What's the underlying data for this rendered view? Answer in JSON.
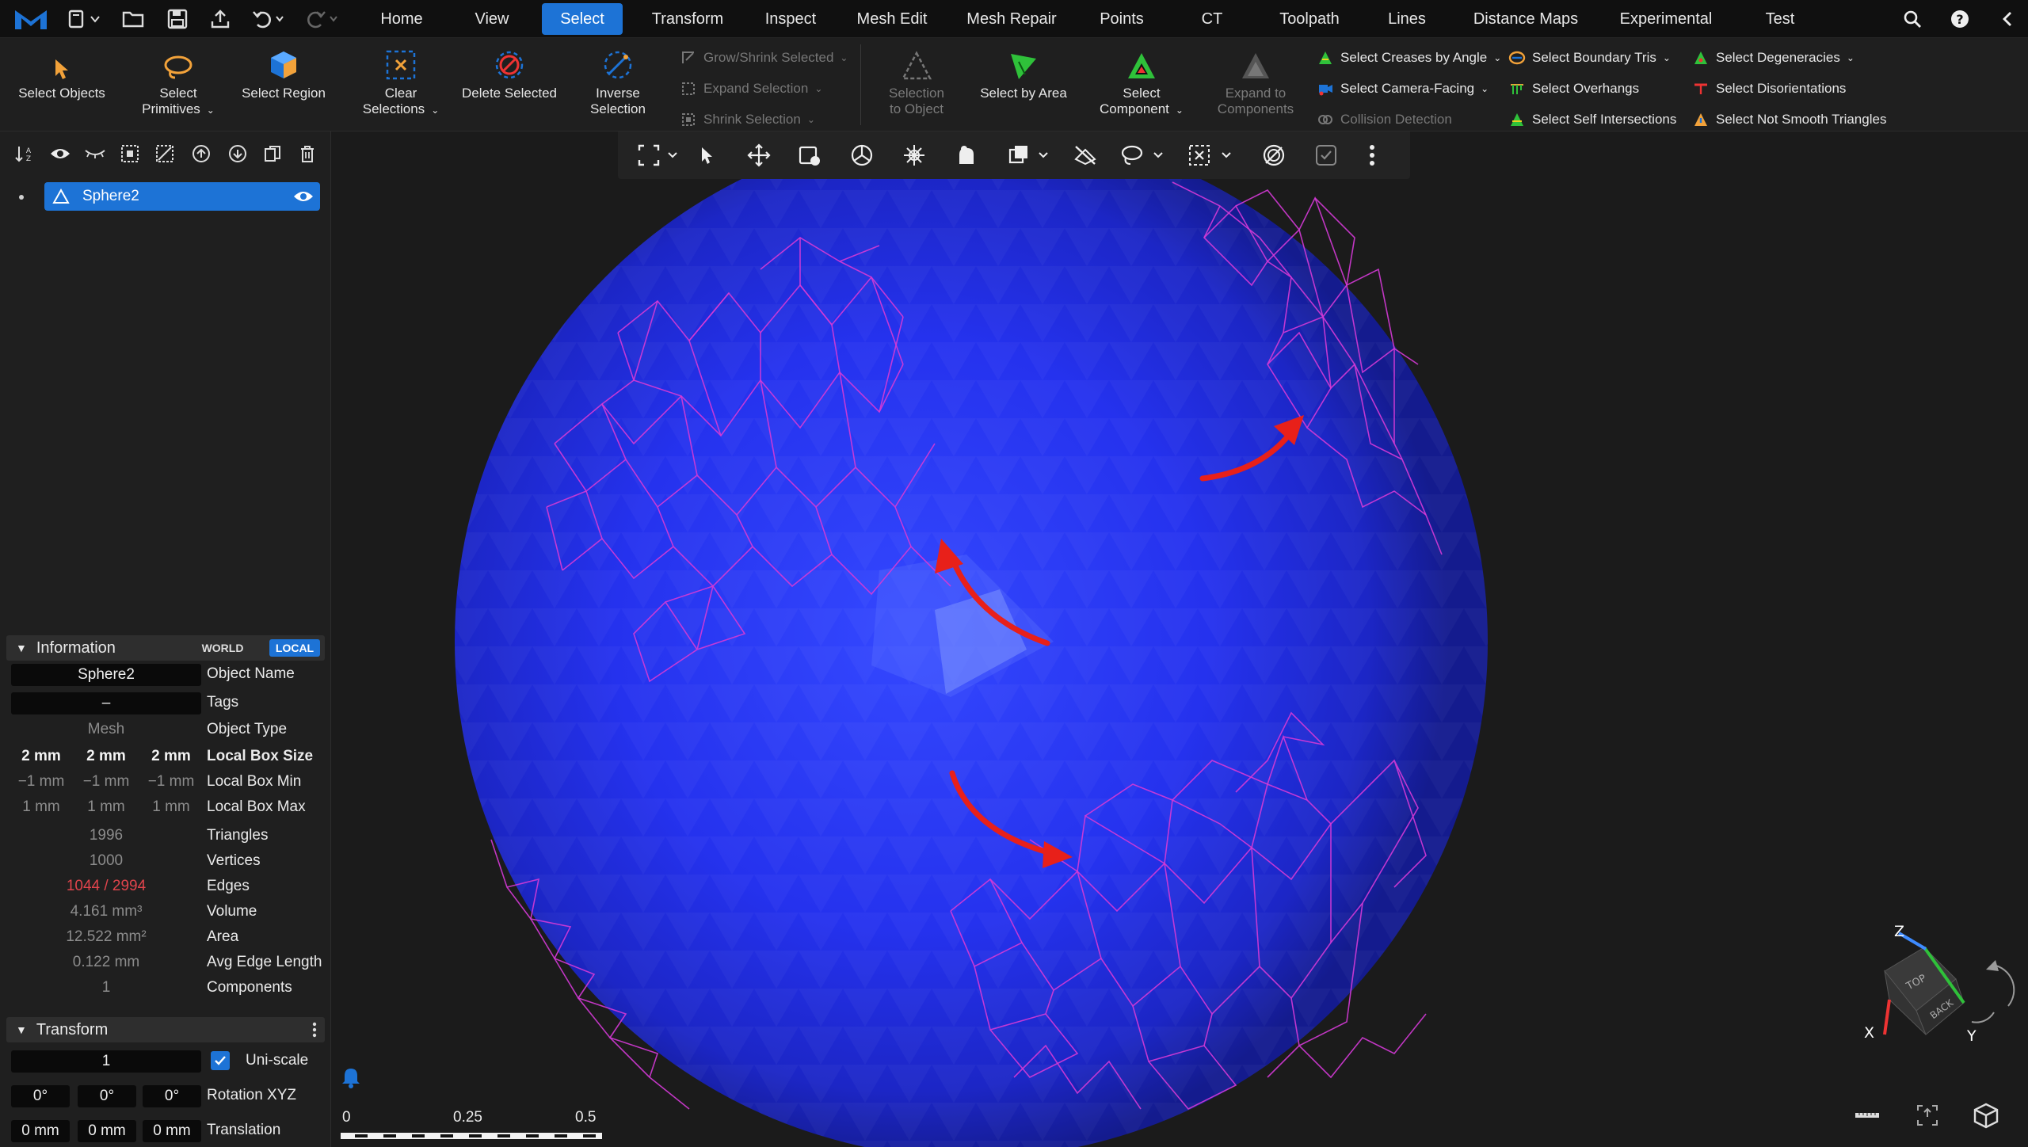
{
  "menubar": {
    "tabs": [
      "Home",
      "View",
      "Select",
      "Transform",
      "Inspect",
      "Mesh Edit",
      "Mesh Repair",
      "Points",
      "CT",
      "Toolpath",
      "Lines",
      "Distance Maps",
      "Experimental",
      "Test"
    ],
    "active_tab": "Select"
  },
  "ribbon": {
    "select_objects": "Select Objects",
    "select_primitives": "Select\nPrimitives",
    "select_region": "Select Region",
    "clear_selections": "Clear\nSelections",
    "delete_selected": "Delete Selected",
    "inverse_selection": "Inverse\nSelection",
    "grow_shrink_selected": "Grow/Shrink Selected",
    "expand_selection": "Expand Selection",
    "shrink_selection": "Shrink Selection",
    "selection_to_object": "Selection\nto Object",
    "select_by_area": "Select by Area",
    "select_component": "Select\nComponent",
    "expand_to_components": "Expand to\nComponents",
    "select_creases_by_angle": "Select Creases by Angle",
    "select_camera_facing": "Select Camera-Facing",
    "collision_detection": "Collision Detection",
    "select_boundary_tris": "Select Boundary Tris",
    "select_overhangs": "Select Overhangs",
    "select_self_intersections": "Select Self Intersections",
    "select_degeneracies": "Select Degeneracies",
    "select_disorientations": "Select Disorientations",
    "select_not_smooth_triangles": "Select Not Smooth Triangles"
  },
  "scene_tree": {
    "items": [
      {
        "label": "Sphere2",
        "visible": true,
        "selected": true
      }
    ]
  },
  "information": {
    "title": "Information",
    "world_label": "WORLD",
    "local_label": "LOCAL",
    "active_frame": "LOCAL",
    "object_name_value": "Sphere2",
    "object_name_label": "Object Name",
    "tags_value": "–",
    "tags_label": "Tags",
    "object_type_value": "Mesh",
    "object_type_label": "Object Type",
    "local_box_size": [
      "2 mm",
      "2 mm",
      "2 mm"
    ],
    "local_box_size_label": "Local Box Size",
    "local_box_min": [
      "−1 mm",
      "−1 mm",
      "−1 mm"
    ],
    "local_box_min_label": "Local Box Min",
    "local_box_max": [
      "1 mm",
      "1 mm",
      "1 mm"
    ],
    "local_box_max_label": "Local Box Max",
    "triangles_value": "1996",
    "triangles_label": "Triangles",
    "vertices_value": "1000",
    "vertices_label": "Vertices",
    "edges_value": "1044 / 2994",
    "edges_label": "Edges",
    "volume_value": "4.161 mm³",
    "volume_label": "Volume",
    "area_value": "12.522 mm²",
    "area_label": "Area",
    "avg_edge_length_value": "0.122 mm",
    "avg_edge_length_label": "Avg Edge Length",
    "components_value": "1",
    "components_label": "Components"
  },
  "transform": {
    "title": "Transform",
    "scale_value": "1",
    "uniscale_label": "Uni-scale",
    "uniscale_checked": true,
    "rotation": [
      "0°",
      "0°",
      "0°"
    ],
    "rotation_label": "Rotation XYZ",
    "translation": [
      "0 mm",
      "0 mm",
      "0 mm"
    ],
    "translation_label": "Translation"
  },
  "viewport": {
    "scale_labels": [
      "0",
      "0.25",
      "0.5"
    ],
    "view_cube": {
      "axis_x": "X",
      "axis_y": "Y",
      "axis_z": "Z",
      "face_top": "TOP",
      "face_back": "BACK"
    },
    "colors": {
      "mesh": "#2230e6",
      "selection_edges": "#d43ad6",
      "arrows": "#e8201a",
      "accent": "#1d73d6"
    }
  }
}
